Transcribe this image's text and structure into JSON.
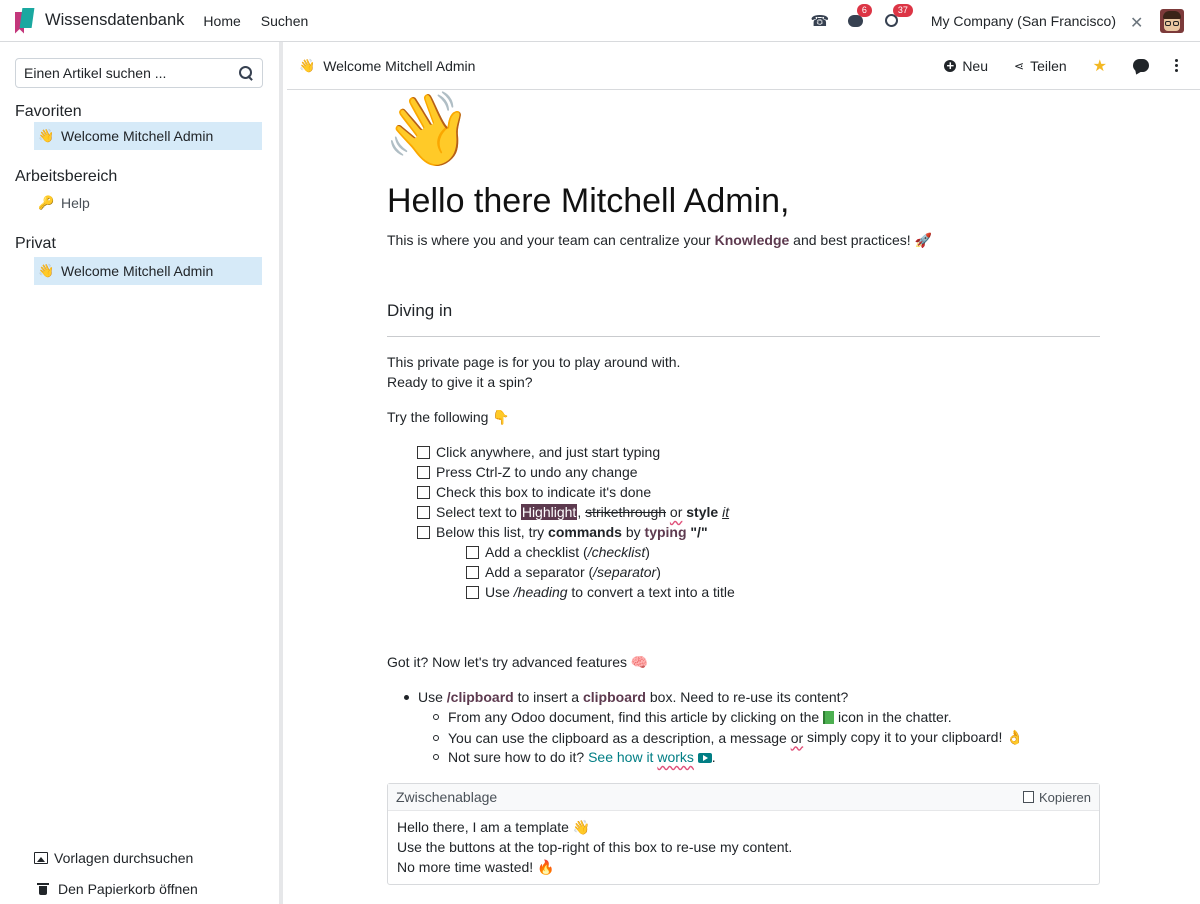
{
  "topbar": {
    "app_name": "Wissensdatenbank",
    "nav": [
      "Home",
      "Suchen"
    ],
    "badge_messages": "6",
    "badge_activities": "37",
    "company": "My Company (San Francisco)"
  },
  "sidebar": {
    "search_placeholder": "Einen Artikel suchen ...",
    "favorites_title": "Favoriten",
    "favorites": [
      {
        "icon": "👋",
        "label": "Welcome Mitchell Admin"
      }
    ],
    "workspace_title": "Arbeitsbereich",
    "workspace": [
      {
        "icon": "🔑",
        "label": "Help"
      }
    ],
    "private_title": "Privat",
    "private": [
      {
        "icon": "👋",
        "label": "Welcome Mitchell Admin"
      }
    ],
    "browse_templates": "Vorlagen durchsuchen",
    "open_trash": "Den Papierkorb öffnen"
  },
  "header": {
    "crumb_icon": "👋",
    "crumb_title": "Welcome Mitchell Admin",
    "new_label": "Neu",
    "share_label": "Teilen"
  },
  "article": {
    "cover_emoji": "👋",
    "title": "Hello there Mitchell Admin,",
    "intro_pre": "This is where you and your team can centralize your ",
    "intro_bold": "Knowledge",
    "intro_post": " and best practices! 🚀",
    "h2": "Diving in",
    "p1": "This private page is for you to play around with.",
    "p2": "Ready to give it a spin?",
    "p3": "Try the following 👇",
    "check1": "Click anywhere, and just start typing",
    "check2": "Press Ctrl-Z to undo any change",
    "check3": "Check this box to indicate it's done",
    "check4": {
      "pre": "Select text to ",
      "highlight": "Highlight",
      "comma": ", ",
      "strike": "strikethrough",
      "space": " ",
      "or": "or",
      "space2": " ",
      "style": "style",
      "space3": " ",
      "it": "it"
    },
    "check5": {
      "pre": "Below this list, try ",
      "commands": "commands",
      "by": " by ",
      "typing": "typing",
      "quote": " \"/\""
    },
    "sub1": {
      "pre": "Add a checklist (",
      "cmd": "/checklist",
      "post": ")"
    },
    "sub2": {
      "pre": "Add a separator (",
      "cmd": "/separator",
      "post": ")"
    },
    "sub3": {
      "pre": "Use ",
      "cmd": "/heading",
      "post": " to convert a text into a title"
    },
    "p4": "Got it? Now let's try advanced features 🧠",
    "b1": {
      "pre": "Use ",
      "cmd": "/clipboard",
      "mid": " to insert a ",
      "bold": "clipboard",
      "post": " box. Need to re-use its content?"
    },
    "b2": {
      "pre": "From any Odoo document, find this article by clicking on the ",
      "post": " icon in the chatter."
    },
    "b3": {
      "pre": "You can use the clipboard as a description, a message ",
      "or": "or",
      "post": " simply copy it to your clipboard! 👌"
    },
    "b4": {
      "pre": "Not sure how to do it? ",
      "link1": "See how it ",
      "link2": "works",
      "post": "."
    },
    "clipboard": {
      "title": "Zwischenablage",
      "copy_label": "Kopieren",
      "lines": [
        "Hello there, I am a template 👋",
        "Use the buttons at the top-right of this box to re-use my content.",
        "No more time wasted! 🔥"
      ]
    }
  }
}
